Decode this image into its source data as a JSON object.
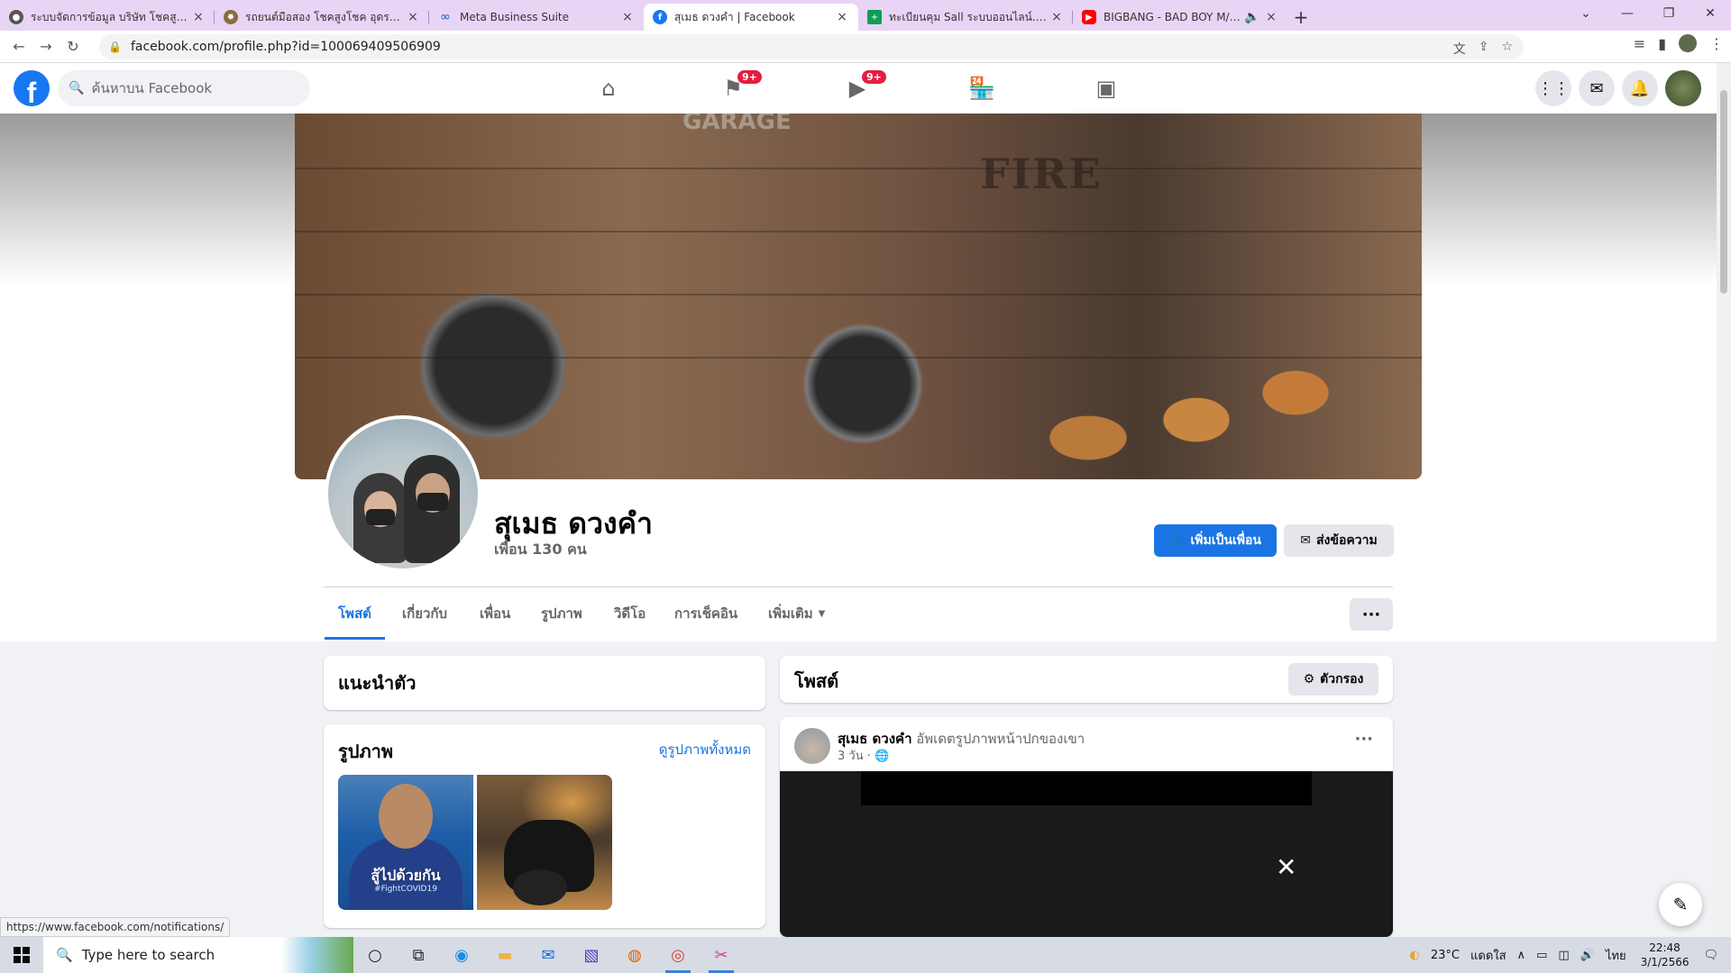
{
  "browser": {
    "tabs": [
      {
        "title": "ระบบจัดการข้อมูล บริษัท โชคสูงโชค",
        "favicon_color": "#555555",
        "active": false
      },
      {
        "title": "รถยนต์มือสอง โชคสูงโชค อุดรธานี",
        "favicon_color": "#8a6d3b",
        "active": false
      },
      {
        "title": "Meta Business Suite",
        "favicon_color": "#0a66c2",
        "active": false
      },
      {
        "title": "สุเมธ ดวงคำ | Facebook",
        "favicon_color": "#1877f2",
        "active": true
      },
      {
        "title": "ทะเบียนคุม Sall ระบบออนไลน์.xlsx - G",
        "favicon_color": "#0f9d58",
        "active": false
      },
      {
        "title": "BIGBANG - BAD BOY M/V - Y",
        "favicon_color": "#ff0000",
        "active": false
      }
    ],
    "url": "facebook.com/profile.php?id=100069409506909"
  },
  "facebook": {
    "search_placeholder": "ค้นหาบน Facebook",
    "badges": {
      "pages": "9+",
      "watch": "9+"
    },
    "profile": {
      "name": "สุเมธ ดวงคำ",
      "friends": "เพื่อน 130 คน",
      "add_friend_label": "เพิ่มเป็นเพื่อน",
      "message_label": "ส่งข้อความ"
    },
    "profile_tabs": [
      {
        "label": "โพสต์",
        "active": true
      },
      {
        "label": "เกี่ยวกับ",
        "active": false
      },
      {
        "label": "เพื่อน",
        "active": false
      },
      {
        "label": "รูปภาพ",
        "active": false
      },
      {
        "label": "วิดีโอ",
        "active": false
      },
      {
        "label": "การเช็คอิน",
        "active": false
      },
      {
        "label": "เพิ่มเติม",
        "active": false
      }
    ],
    "intro": {
      "title": "แนะนำตัว"
    },
    "photos": {
      "title": "รูปภาพ",
      "see_all": "ดูรูปภาพทั้งหมด",
      "photo1_caption": "สู้ไปด้วยกัน",
      "photo1_tag": "#FightCOVID19"
    },
    "posts": {
      "title": "โพสต์",
      "filter_label": "ตัวกรอง",
      "post": {
        "author": "สุเมธ ดวงคำ",
        "action": "อัพเดตรูปภาพหน้าปกของเขา",
        "time": "3 วัน"
      }
    },
    "status_url": "https://www.facebook.com/notifications/"
  },
  "taskbar": {
    "search_placeholder": "Type here to search",
    "weather": "23°C",
    "weather_desc": "แดดใส",
    "lang": "ไทย",
    "time": "22:48",
    "date": "3/1/2566"
  },
  "colors": {
    "fb_blue": "#1877f2",
    "badge_red": "#e41e3f",
    "tab_strip": "#e8d4f4"
  }
}
